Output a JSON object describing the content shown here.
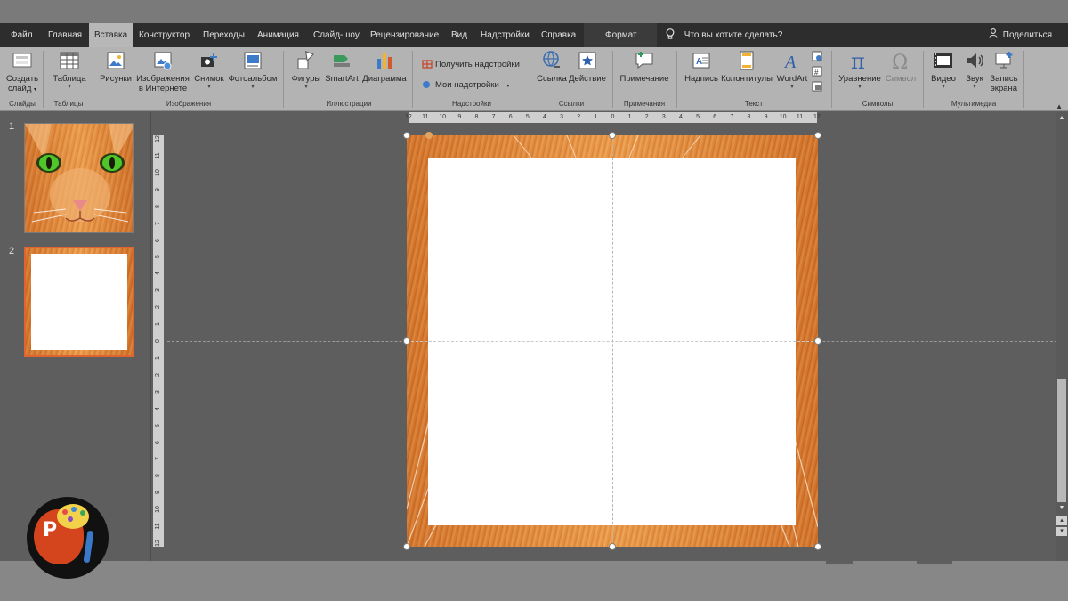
{
  "tabs": {
    "file": "Файл",
    "home": "Главная",
    "insert": "Вставка",
    "design": "Конструктор",
    "transitions": "Переходы",
    "animation": "Анимация",
    "slideshow": "Слайд-шоу",
    "review": "Рецензирование",
    "view": "Вид",
    "addins": "Надстройки",
    "help": "Справка",
    "format": "Формат",
    "active": "Вставка"
  },
  "tell_me": "Что вы хотите сделать?",
  "share": "Поделиться",
  "ribbon": {
    "slides": {
      "new_slide_1": "Создать",
      "new_slide_2": "слайд",
      "label": "Слайды"
    },
    "tables": {
      "table": "Таблица",
      "label": "Таблицы"
    },
    "images": {
      "pictures": "Рисунки",
      "online_1": "Изображения",
      "online_2": "в Интернете",
      "screenshot": "Снимок",
      "album": "Фотоальбом",
      "label": "Изображения"
    },
    "illustrations": {
      "shapes": "Фигуры",
      "smartart": "SmartArt",
      "chart": "Диаграмма",
      "label": "Иллюстрации"
    },
    "addins": {
      "get": "Получить надстройки",
      "my": "Мои надстройки",
      "label": "Надстройки"
    },
    "links": {
      "link": "Ссылка",
      "action": "Действие",
      "label": "Ссылки"
    },
    "comments": {
      "comment": "Примечание",
      "label": "Примечания"
    },
    "text": {
      "textbox": "Надпись",
      "header_footer": "Колонтитулы",
      "wordart": "WordArt",
      "label": "Текст"
    },
    "symbols": {
      "equation": "Уравнение",
      "symbol": "Символ",
      "label": "Символы"
    },
    "media": {
      "video": "Видео",
      "audio": "Звук",
      "record_1": "Запись",
      "record_2": "экрана",
      "label": "Мультимедиа"
    }
  },
  "slides": {
    "numbers": [
      "1",
      "2"
    ]
  },
  "ruler": {
    "h": [
      "12",
      "11",
      "10",
      "9",
      "8",
      "7",
      "6",
      "5",
      "4",
      "3",
      "2",
      "1",
      "0",
      "1",
      "2",
      "3",
      "4",
      "5",
      "6",
      "7",
      "8",
      "9",
      "10",
      "11",
      "12"
    ],
    "v": [
      "12",
      "11",
      "10",
      "9",
      "8",
      "7",
      "6",
      "5",
      "4",
      "3",
      "2",
      "1",
      "0",
      "1",
      "2",
      "3",
      "4",
      "5",
      "6",
      "7",
      "8",
      "9",
      "10",
      "11",
      "12"
    ]
  },
  "colors": {
    "accent": "#e0642f",
    "ribbon": "#b3b3b3",
    "tabbar": "#2d2d2d",
    "workspace": "#5e5e5e",
    "fur": "#d97b2c"
  },
  "icons": {
    "tell_me": "lightbulb-icon",
    "share": "person-icon",
    "badge": "powerpoint-paint-logo"
  }
}
